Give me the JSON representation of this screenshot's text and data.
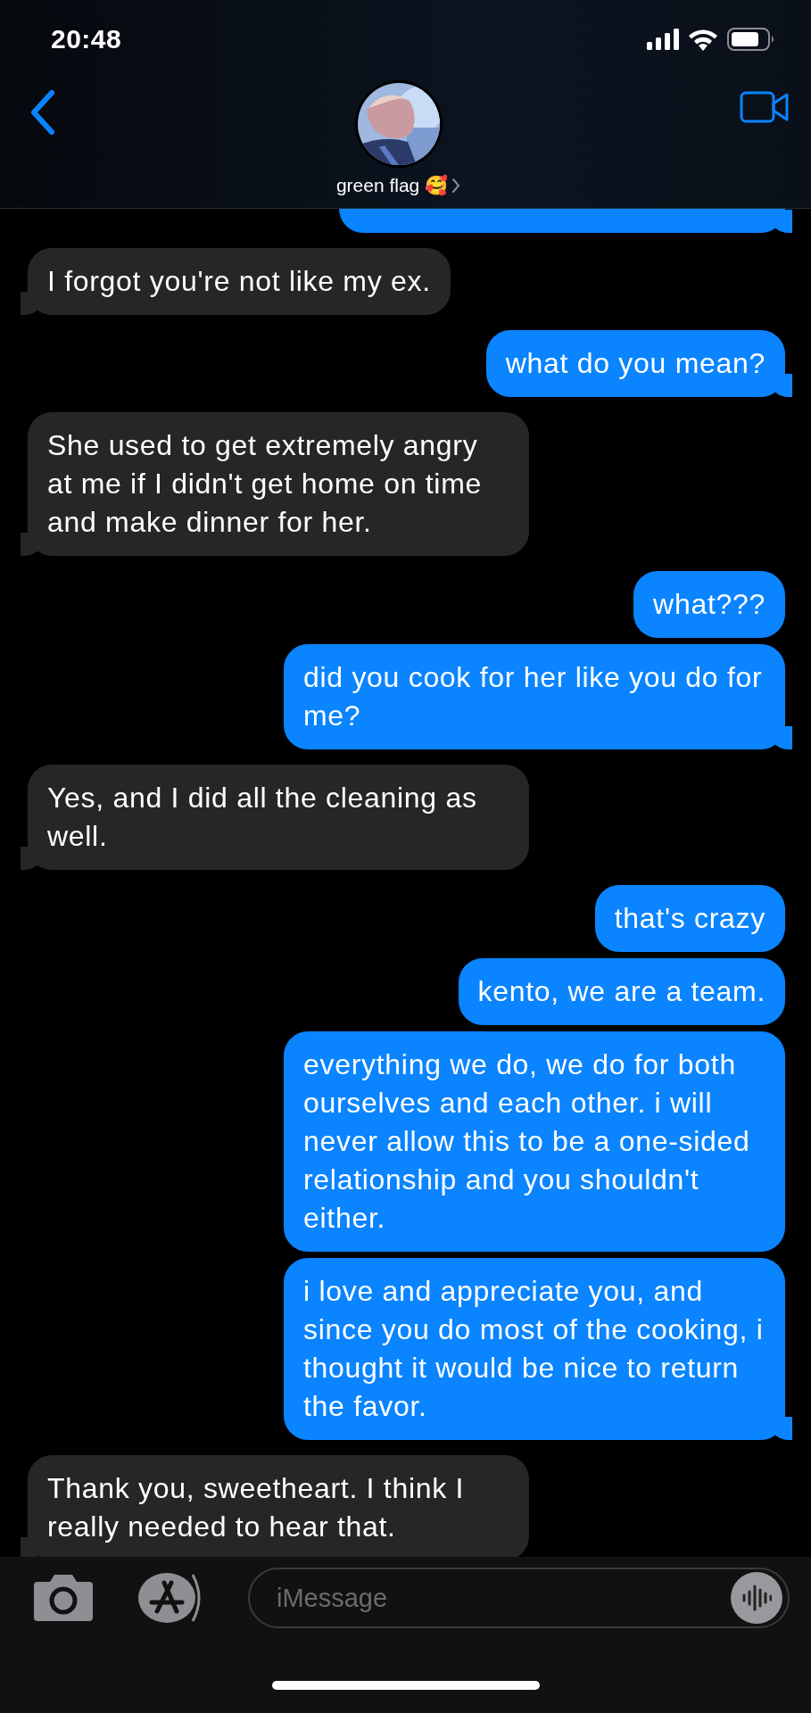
{
  "status_bar": {
    "time": "20:48"
  },
  "header": {
    "contact_name": "green flag 🥰"
  },
  "messages": [
    {
      "kind": "sent"
    },
    {
      "kind": "received",
      "text": "I forgot you're not like my ex."
    },
    {
      "kind": "sent",
      "text": "what do you mean?"
    },
    {
      "kind": "received",
      "text": "She used to get extremely angry at me if I didn't get home on time and make dinner for her."
    },
    {
      "kind": "sent",
      "text": "what???"
    },
    {
      "kind": "sent",
      "text": "did you cook for her like you do for me?"
    },
    {
      "kind": "received",
      "text": "Yes, and I did all the cleaning as well."
    },
    {
      "kind": "sent",
      "text": "that's crazy"
    },
    {
      "kind": "sent",
      "text": "kento, we are a team."
    },
    {
      "kind": "sent",
      "text": "everything we do, we do for both ourselves and each other. i will never allow this to be a one-sided relationship and you shouldn't either."
    },
    {
      "kind": "sent",
      "text": "i love and appreciate you, and since you do most of the cooking, i thought it would be nice to return the favor."
    },
    {
      "kind": "received",
      "text": "Thank you, sweetheart. I think I really needed to hear that."
    }
  ],
  "composer": {
    "placeholder": "iMessage"
  }
}
